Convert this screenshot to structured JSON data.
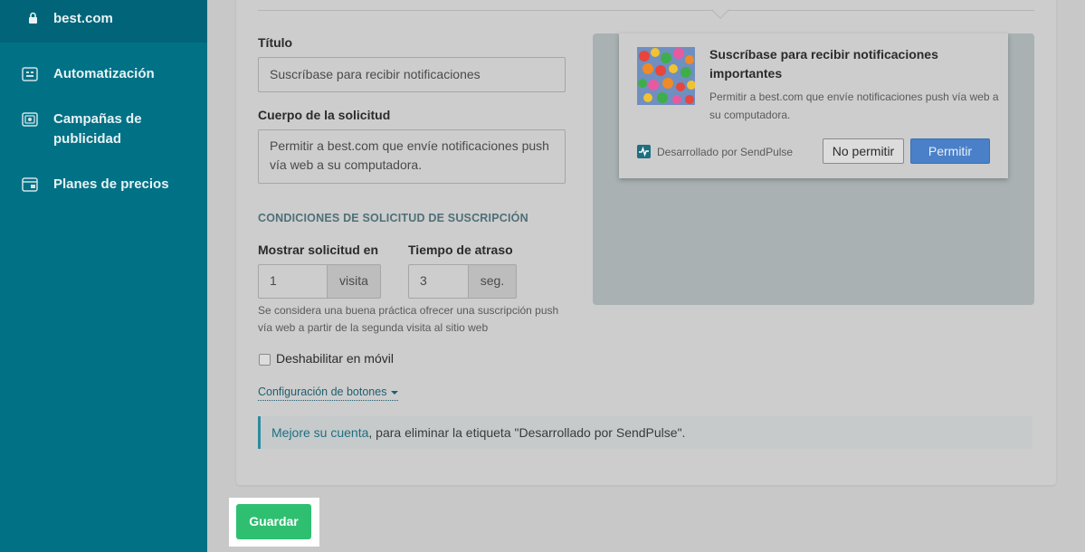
{
  "sidebar": {
    "site": "best.com",
    "items": [
      {
        "label": "Automatización",
        "icon": "automation-icon"
      },
      {
        "label": "Campañas de publicidad",
        "icon": "campaigns-icon"
      },
      {
        "label": "Planes de precios",
        "icon": "pricing-icon"
      }
    ]
  },
  "form": {
    "title_label": "Título",
    "title_value": "Suscríbase para recibir notificaciones",
    "body_label": "Cuerpo de la solicitud",
    "body_value": "Permitir a best.com que envíe notificaciones push vía web a su computadora.",
    "conditions_title": "CONDICIONES DE SOLICITUD DE SUSCRIPCIÓN",
    "show_label": "Mostrar solicitud en",
    "show_value": "1",
    "show_unit": "visita",
    "delay_label": "Tiempo de atraso",
    "delay_value": "3",
    "delay_unit": "seg.",
    "hint": "Se considera una buena práctica ofrecer una suscripción push vía web a partir de la segunda visita al sitio web",
    "mobile_label": "Deshabilitar en móvil",
    "buttons_config": "Configuración de botones"
  },
  "notice": {
    "link": "Mejore su cuenta",
    "text": ", para eliminar la etiqueta \"Desarrollado por SendPulse\"."
  },
  "preview": {
    "title": "Suscríbase para recibir notificaciones importantes",
    "body": "Permitir a best.com que envíe notificaciones push vía web a su computadora.",
    "brand": "Desarrollado por SendPulse",
    "deny": "No permitir",
    "allow": "Permitir"
  },
  "save_label": "Guardar",
  "colors": {
    "sidebar": "#017186",
    "save": "#2fbf71",
    "allow": "#4a80c8"
  }
}
